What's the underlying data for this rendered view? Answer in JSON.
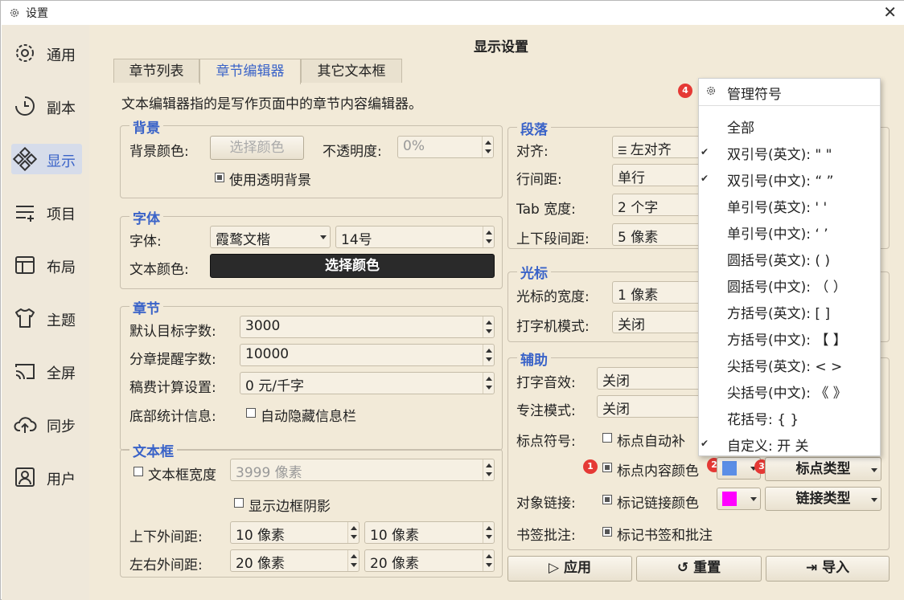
{
  "window": {
    "title": "设置"
  },
  "sidebar": {
    "items": [
      {
        "label": "通用",
        "icon": "gear-icon"
      },
      {
        "label": "副本",
        "icon": "backup-clock-icon"
      },
      {
        "label": "显示",
        "icon": "display-grid-icon",
        "active": true
      },
      {
        "label": "项目",
        "icon": "list-add-icon"
      },
      {
        "label": "布局",
        "icon": "layout-icon"
      },
      {
        "label": "主题",
        "icon": "tshirt-icon"
      },
      {
        "label": "全屏",
        "icon": "cast-icon"
      },
      {
        "label": "同步",
        "icon": "cloud-upload-icon"
      },
      {
        "label": "用户",
        "icon": "user-icon"
      }
    ]
  },
  "page": {
    "title": "显示设置"
  },
  "tabs": [
    "章节列表",
    "章节编辑器",
    "其它文本框"
  ],
  "description": "文本编辑器指的是写作页面中的章节内容编辑器。",
  "background": {
    "title": "背景",
    "color_label": "背景颜色:",
    "color_button": "选择颜色",
    "opacity_label": "不透明度:",
    "opacity_value": "0%",
    "transparent_label": "使用透明背景"
  },
  "font": {
    "title": "字体",
    "font_label": "字体:",
    "font_value": "霞鹜文楷",
    "size_value": "14号",
    "color_label": "文本颜色:",
    "color_button": "选择颜色"
  },
  "chapter": {
    "title": "章节",
    "target_label": "默认目标字数:",
    "target_value": "3000",
    "remind_label": "分章提醒字数:",
    "remind_value": "10000",
    "fee_label": "稿费计算设置:",
    "fee_value": "0 元/千字",
    "stats_label": "底部统计信息:",
    "autohide_label": "自动隐藏信息栏"
  },
  "textbox": {
    "title": "文本框",
    "width_label": "文本框宽度",
    "width_value": "3999 像素",
    "shadow_label": "显示边框阴影",
    "tb_margin_label": "上下外间距:",
    "tb_margin_1": "10 像素",
    "tb_margin_2": "10 像素",
    "lr_margin_label": "左右外间距:",
    "lr_margin_1": "20 像素",
    "lr_margin_2": "20 像素"
  },
  "paragraph": {
    "title": "段落",
    "align_label": "对齐:",
    "align_value": "左对齐",
    "line_label": "行间距:",
    "line_value": "单行",
    "tab_label": "Tab 宽度:",
    "tab_value": "2 个字",
    "spacing_label": "上下段间距:",
    "spacing_value": "5 像素"
  },
  "cursor": {
    "title": "光标",
    "width_label": "光标的宽度:",
    "width_value": "1 像素",
    "typewriter_label": "打字机模式:",
    "typewriter_value": "关闭"
  },
  "assist": {
    "title": "辅助",
    "sound_label": "打字音效:",
    "sound_value": "关闭",
    "focus_label": "专注模式:",
    "focus_value": "关闭",
    "punct_label": "标点符号:",
    "autocomplete_label": "标点自动补",
    "punct_color_label": "标点内容颜色",
    "punct_type_button": "标点类型",
    "link_label": "对象链接:",
    "link_color_label": "标记链接颜色",
    "link_type_button": "链接类型",
    "bookmark_label": "书签批注:",
    "bookmark_mark_label": "标记书签和批注"
  },
  "colors": {
    "accent": "#3a63c8",
    "punct_swatch": "#5b8ee6",
    "link_swatch": "#ff00ff",
    "badge": "#e53935"
  },
  "buttons": {
    "apply": "应用",
    "reset": "重置",
    "import": "导入"
  },
  "badges": [
    "1",
    "2",
    "3",
    "4"
  ],
  "menu": {
    "header": "管理符号",
    "items": [
      {
        "label": "全部",
        "checked": false
      },
      {
        "label": "双引号(英文): \" \"",
        "checked": true
      },
      {
        "label": "双引号(中文): “ ”",
        "checked": true
      },
      {
        "label": "单引号(英文): ' '",
        "checked": false
      },
      {
        "label": "单引号(中文): ‘ ’",
        "checked": false
      },
      {
        "label": "圆括号(英文): ( )",
        "checked": false
      },
      {
        "label": "圆括号(中文): （ ）",
        "checked": false
      },
      {
        "label": "方括号(英文): [ ]",
        "checked": false
      },
      {
        "label": "方括号(中文): 【 】",
        "checked": false
      },
      {
        "label": "尖括号(英文): < >",
        "checked": false
      },
      {
        "label": "尖括号(中文): 《 》",
        "checked": false
      },
      {
        "label": "花括号: { }",
        "checked": false
      },
      {
        "label": "自定义: 开 关",
        "checked": true
      }
    ]
  }
}
